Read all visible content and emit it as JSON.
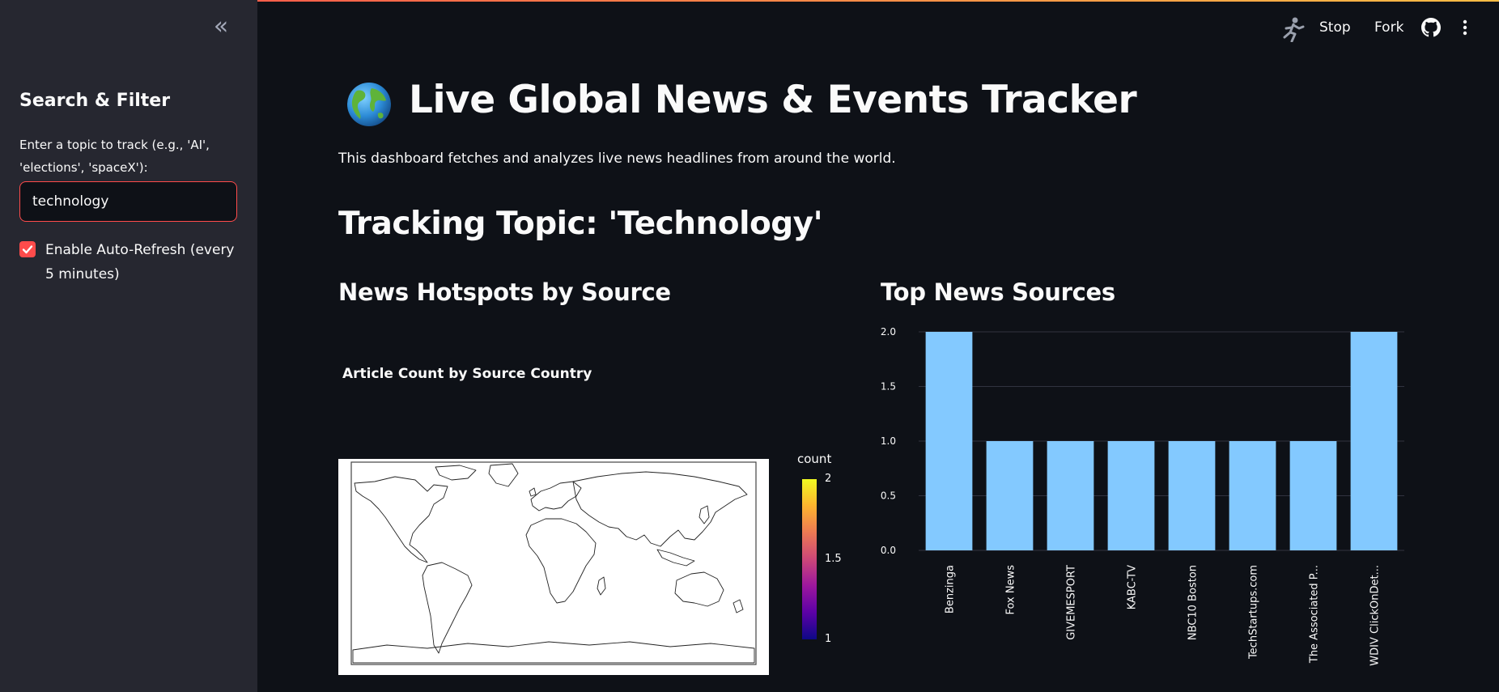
{
  "sidebar": {
    "collapse_icon": "double-chevron-left-icon",
    "heading": "Search & Filter",
    "input_label": "Enter a topic to track (e.g., 'AI', 'elections', 'spaceX'):",
    "input_value": "technology",
    "auto_refresh_label": "Enable Auto-Refresh (every 5 minutes)",
    "auto_refresh_checked": true,
    "accent_color": "#ff4b4b"
  },
  "header": {
    "stop_label": "Stop",
    "fork_label": "Fork",
    "icons": [
      "running-man-icon",
      "github-icon",
      "kebab-menu-icon"
    ]
  },
  "main": {
    "title_icon": "globe-icon",
    "title": "Live Global News & Events Tracker",
    "intro": "This dashboard fetches and analyzes live news headlines from around the world.",
    "topic_heading": "Tracking Topic: 'Technology'",
    "left_section": "News Hotspots by Source",
    "right_section": "Top News Sources"
  },
  "map_chart": {
    "title": "Article Count by Source Country",
    "colorbar_title": "count",
    "colorbar_ticks": [
      "2",
      "1.5",
      "1"
    ],
    "colorscale": [
      "#0d0887",
      "#5c01a6",
      "#9c179e",
      "#cc4778",
      "#ed7953",
      "#fdb42f",
      "#f0f921"
    ]
  },
  "chart_data": {
    "type": "bar",
    "categories": [
      "Benzinga",
      "Fox News",
      "GIVEMESPORT",
      "KABC-TV",
      "NBC10 Boston",
      "TechStartups.com",
      "The Associated P...",
      "WDIV ClickOnDet..."
    ],
    "values": [
      2,
      1,
      1,
      1,
      1,
      1,
      1,
      2
    ],
    "ylim": [
      0,
      2
    ],
    "yticks": [
      "0.0",
      "0.5",
      "1.0",
      "1.5",
      "2.0"
    ],
    "bar_color": "#83c9ff",
    "grid": true,
    "title": "",
    "xlabel": "",
    "ylabel": ""
  }
}
